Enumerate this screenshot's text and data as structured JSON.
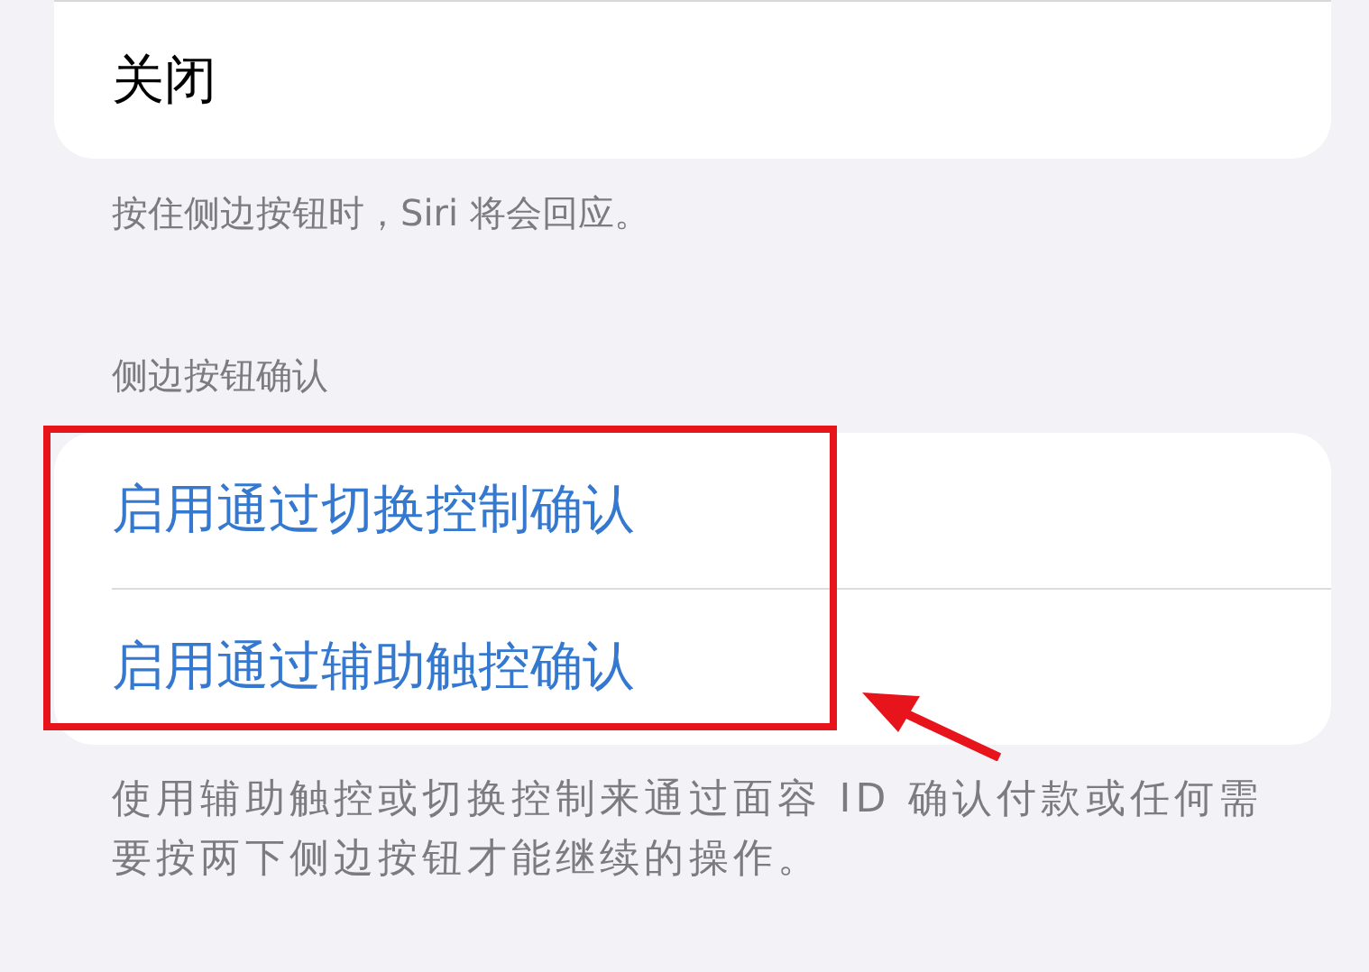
{
  "groups": [
    {
      "items": [
        {
          "label": "关闭",
          "kind": "plain"
        }
      ],
      "footer": "按住侧边按钮时，Siri 将会回应。"
    },
    {
      "header": "侧边按钮确认",
      "items": [
        {
          "label": "启用通过切换控制确认",
          "kind": "link"
        },
        {
          "label": "启用通过辅助触控确认",
          "kind": "link"
        }
      ],
      "footer": "使用辅助触控或切换控制来通过面容 ID 确认付款或任何需要按两下侧边按钮才能继续的操作。"
    }
  ]
}
